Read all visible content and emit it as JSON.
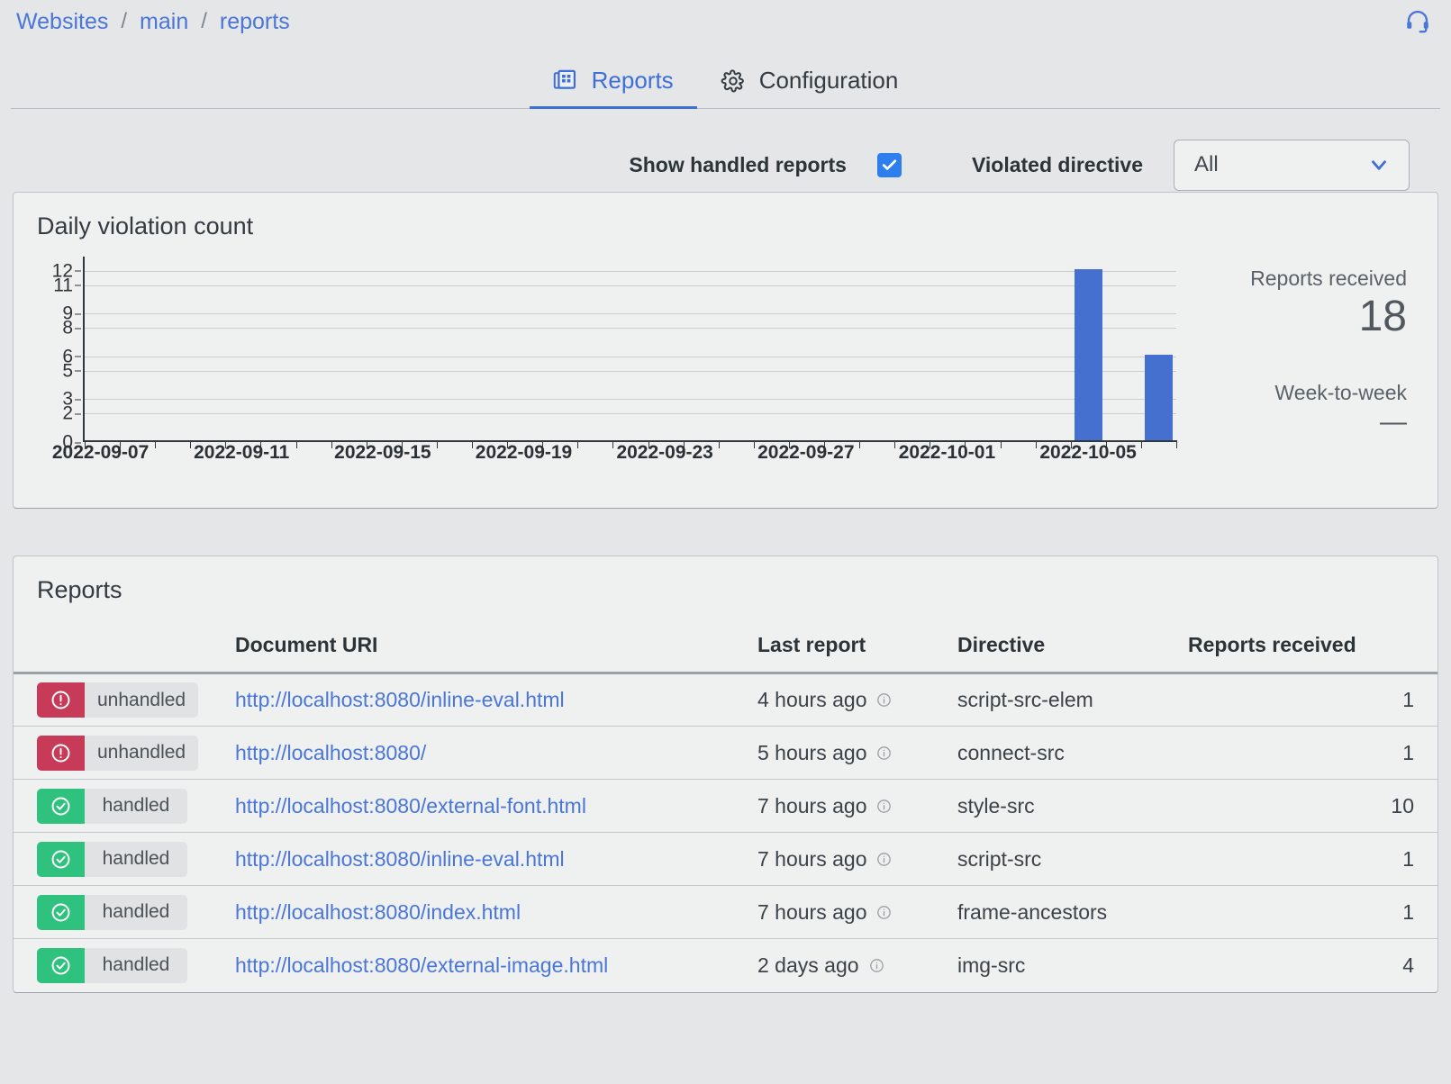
{
  "breadcrumb": {
    "items": [
      "Websites",
      "main",
      "reports"
    ],
    "separator": "/"
  },
  "support": {
    "icon": "headset-icon"
  },
  "tabs": [
    {
      "label": "Reports",
      "icon": "reports-icon",
      "active": true
    },
    {
      "label": "Configuration",
      "icon": "gear-icon",
      "active": false
    }
  ],
  "filters": {
    "show_handled_label": "Show handled reports",
    "show_handled_checked": true,
    "violated_directive_label": "Violated directive",
    "violated_directive_value": "All",
    "violated_directive_options": [
      "All"
    ]
  },
  "chart_card": {
    "title": "Daily violation count",
    "stats": [
      {
        "label": "Reports received",
        "value": "18"
      },
      {
        "label": "Week-to-week",
        "value": "—"
      }
    ]
  },
  "chart_data": {
    "type": "bar",
    "title": "Daily violation count",
    "xlabel": "",
    "ylabel": "",
    "grid": true,
    "legend": false,
    "ylim": [
      0,
      13
    ],
    "yticks": [
      0,
      2,
      3,
      5,
      6,
      8,
      9,
      11,
      12
    ],
    "xtick_labels": [
      "2022-09-07",
      "2022-09-11",
      "2022-09-15",
      "2022-09-19",
      "2022-09-23",
      "2022-09-27",
      "2022-10-01",
      "2022-10-05"
    ],
    "categories": [
      "2022-09-07",
      "2022-09-08",
      "2022-09-09",
      "2022-09-10",
      "2022-09-11",
      "2022-09-12",
      "2022-09-13",
      "2022-09-14",
      "2022-09-15",
      "2022-09-16",
      "2022-09-17",
      "2022-09-18",
      "2022-09-19",
      "2022-09-20",
      "2022-09-21",
      "2022-09-22",
      "2022-09-23",
      "2022-09-24",
      "2022-09-25",
      "2022-09-26",
      "2022-09-27",
      "2022-09-28",
      "2022-09-29",
      "2022-09-30",
      "2022-10-01",
      "2022-10-02",
      "2022-10-03",
      "2022-10-04",
      "2022-10-05",
      "2022-10-06",
      "2022-10-07"
    ],
    "values": [
      0,
      0,
      0,
      0,
      0,
      0,
      0,
      0,
      0,
      0,
      0,
      0,
      0,
      0,
      0,
      0,
      0,
      0,
      0,
      0,
      0,
      0,
      0,
      0,
      0,
      0,
      0,
      0,
      12,
      0,
      6
    ],
    "bar_color": "#4570d0"
  },
  "reports_card": {
    "title": "Reports",
    "columns": [
      "",
      "Document URI",
      "Last report",
      "Directive",
      "Reports received"
    ],
    "rows": [
      {
        "status": "unhandled",
        "status_icon": "alert-circle-icon",
        "uri": "http://localhost:8080/inline-eval.html",
        "last_report": "4 hours ago",
        "directive": "script-src-elem",
        "count": "1"
      },
      {
        "status": "unhandled",
        "status_icon": "alert-circle-icon",
        "uri": "http://localhost:8080/",
        "last_report": "5 hours ago",
        "directive": "connect-src",
        "count": "1"
      },
      {
        "status": "handled",
        "status_icon": "check-circle-icon",
        "uri": "http://localhost:8080/external-font.html",
        "last_report": "7 hours ago",
        "directive": "style-src",
        "count": "10"
      },
      {
        "status": "handled",
        "status_icon": "check-circle-icon",
        "uri": "http://localhost:8080/inline-eval.html",
        "last_report": "7 hours ago",
        "directive": "script-src",
        "count": "1"
      },
      {
        "status": "handled",
        "status_icon": "check-circle-icon",
        "uri": "http://localhost:8080/index.html",
        "last_report": "7 hours ago",
        "directive": "frame-ancestors",
        "count": "1"
      },
      {
        "status": "handled",
        "status_icon": "check-circle-icon",
        "uri": "http://localhost:8080/external-image.html",
        "last_report": "2 days ago",
        "directive": "img-src",
        "count": "4"
      }
    ]
  },
  "colors": {
    "page_bg": "#e4e6e8",
    "card_bg": "#eff0f0",
    "link": "#4a76d8",
    "accent": "#3f6fd6",
    "bar": "#4570d0",
    "unhandled": "#c73b59",
    "handled": "#2ec27e",
    "checkbox": "#2d7ff0"
  }
}
